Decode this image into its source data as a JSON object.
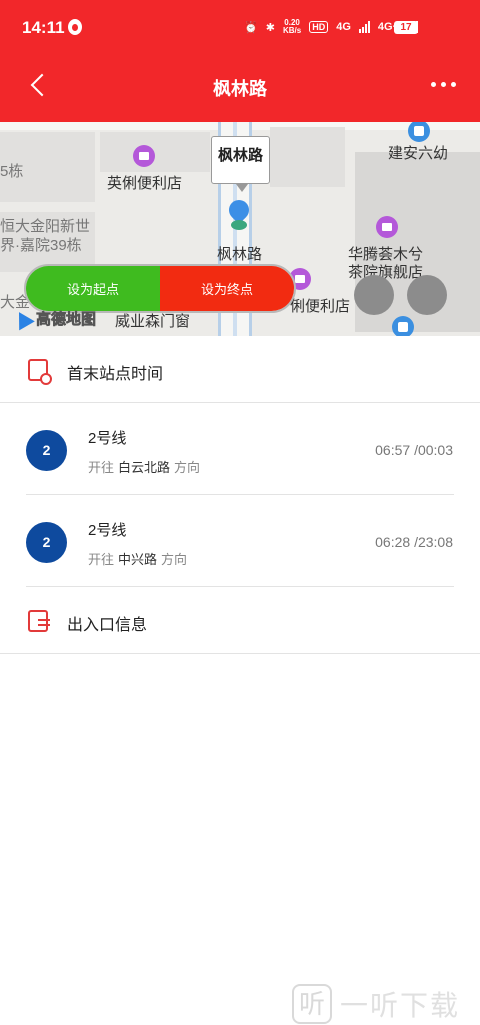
{
  "status_bar": {
    "time": "14:11",
    "speed": "0.20\nKB/s",
    "hd": "HD",
    "net1": "4G",
    "net2": "4G+",
    "battery": "17"
  },
  "header": {
    "title": "枫林路"
  },
  "map": {
    "callout_label": "枫林路",
    "station_label": "枫林路",
    "labels": {
      "block_5": "5栋",
      "shop_1": "英俐便利店",
      "school": "建安六幼",
      "estate_1": "恒大金阳新世",
      "estate_2": "界·嘉院39栋",
      "teahouse_1": "华腾荟木兮",
      "teahouse_2": "茶院旗舰店",
      "shop_2": "俐便利店",
      "estate_3": "大金",
      "wood": "威业森门窗",
      "amap": "高德地图"
    },
    "set_start": "设为起点",
    "set_end": "设为终点"
  },
  "sections": {
    "first_last_label": "首末站点时间",
    "exit_label": "出入口信息"
  },
  "lines": [
    {
      "badge": "2",
      "name": "2号线",
      "prefix": "开往",
      "terminal": "白云北路",
      "suffix": "方向",
      "times": "06:57 /00:03"
    },
    {
      "badge": "2",
      "name": "2号线",
      "prefix": "开往",
      "terminal": "中兴路",
      "suffix": "方向",
      "times": "06:28 /23:08"
    }
  ],
  "watermark": {
    "glyph": "听",
    "text": "一听下载"
  },
  "colors": {
    "header": "#f2272a",
    "start": "#3fbb1f",
    "end": "#f22b11",
    "line2": "#0e4a9e"
  }
}
